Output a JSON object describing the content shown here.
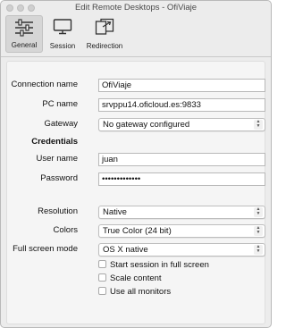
{
  "window": {
    "title": "Edit Remote Desktops - OfiViaje"
  },
  "toolbar": {
    "tabs": [
      {
        "label": "General",
        "icon": "sliders-icon",
        "active": true
      },
      {
        "label": "Session",
        "icon": "monitor-icon",
        "active": false
      },
      {
        "label": "Redirection",
        "icon": "redirection-icon",
        "active": false
      }
    ]
  },
  "form": {
    "connection_name": {
      "label": "Connection name",
      "value": "OfiViaje"
    },
    "pc_name": {
      "label": "PC name",
      "value": "srvppu14.oficloud.es:9833"
    },
    "gateway": {
      "label": "Gateway",
      "value": "No gateway configured"
    },
    "credentials_heading": "Credentials",
    "user_name": {
      "label": "User name",
      "value": "juan"
    },
    "password": {
      "label": "Password",
      "value": "•••••••••••••"
    },
    "resolution": {
      "label": "Resolution",
      "value": "Native"
    },
    "colors": {
      "label": "Colors",
      "value": "True Color (24 bit)"
    },
    "full_screen_mode": {
      "label": "Full screen mode",
      "value": "OS X native"
    },
    "options": [
      {
        "label": "Start session in full screen",
        "checked": false
      },
      {
        "label": "Scale content",
        "checked": false
      },
      {
        "label": "Use all monitors",
        "checked": false
      }
    ]
  }
}
